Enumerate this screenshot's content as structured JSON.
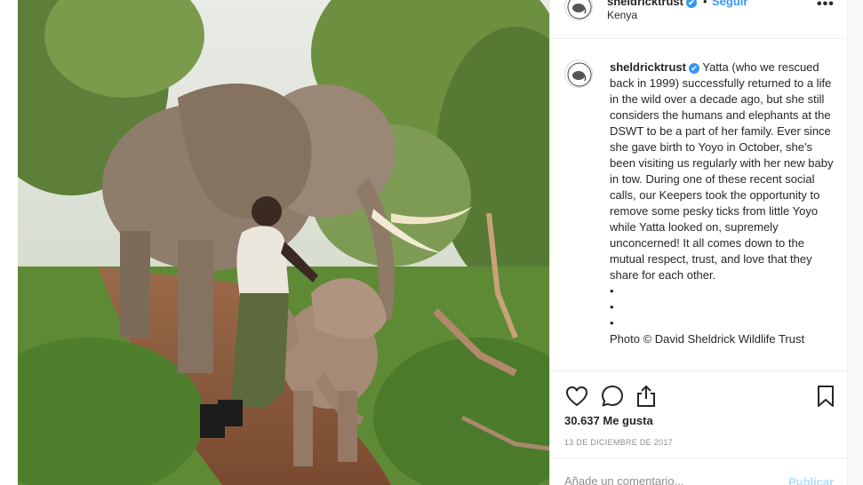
{
  "post": {
    "username": "sheldricktrust",
    "verified_mark": "✔",
    "separator": "•",
    "follow_label": "Seguir",
    "location": "Kenya",
    "more_label": "•••"
  },
  "caption": {
    "username": "sheldricktrust",
    "text": "Yatta (who we rescued back in 1999) successfully returned to a life in the wild over a decade ago, but she still considers the humans and elephants at the DSWT to be a part of her family. Ever since she gave birth to Yoyo in October, she's been visiting us regularly with her new baby in tow. During one of these recent social calls, our Keepers took the opportunity to remove some pesky ticks from little Yoyo while Yatta looked on, supremely unconcerned! It all comes down to the mutual respect, trust, and love that they share for each other.",
    "bullets": [
      "•",
      "•",
      "•"
    ],
    "cut_line": "Photo © David Sheldrick Wildlife Trust"
  },
  "engagement": {
    "likes": "30.637 Me gusta",
    "date": "13 DE DICIEMBRE DE 2017"
  },
  "comment": {
    "placeholder": "Añade un comentario...",
    "publish_label": "Publicar"
  },
  "icons": [
    "heart-icon",
    "comment-icon",
    "share-icon",
    "bookmark-icon",
    "more-options-icon"
  ],
  "colors": {
    "link_blue": "#3897f0",
    "publish_disabled": "#b2dffc",
    "text": "#262626",
    "muted": "#8e8e8e"
  }
}
